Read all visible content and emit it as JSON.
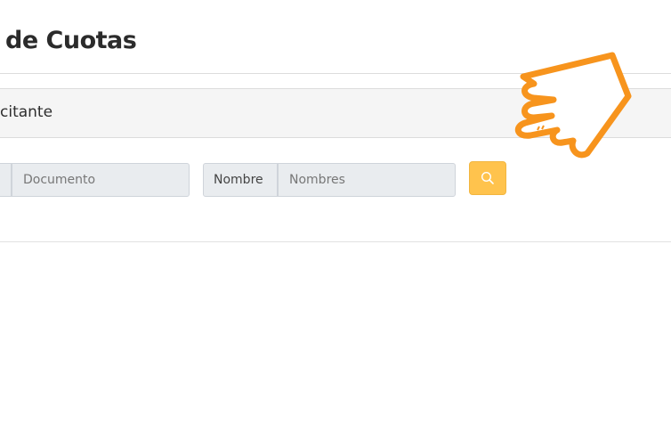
{
  "header": {
    "title": "de Cuotas"
  },
  "section": {
    "label": "citante"
  },
  "search": {
    "document_placeholder": "Documento",
    "name_label": "Nombre",
    "name_placeholder": "Nombres"
  },
  "icons": {
    "search_button_icon": "search-icon",
    "pointer": "pointing-hand-icon"
  },
  "colors": {
    "search_button": "#ffc34d",
    "hand_stroke": "#f7941d"
  }
}
